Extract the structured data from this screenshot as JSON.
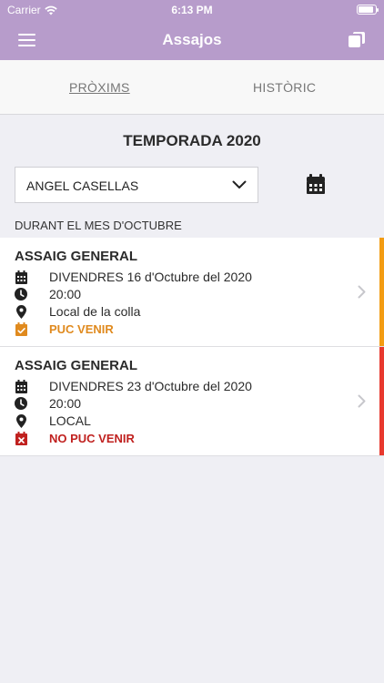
{
  "status_bar": {
    "carrier": "Carrier",
    "time": "6:13 PM",
    "battery_level": 0.9
  },
  "header": {
    "title": "Assajos"
  },
  "tabs": [
    {
      "label": "PRÒXIMS",
      "active": true
    },
    {
      "label": "HISTÒRIC",
      "active": false
    }
  ],
  "season_title": "TEMPORADA 2020",
  "member_select": {
    "value": "ANGEL CASELLAS"
  },
  "month_label": "DURANT EL MES D'OCTUBRE",
  "events": [
    {
      "title": "ASSAIG GENERAL",
      "date": "DIVENDRES 16 d'Octubre del 2020",
      "time": "20:00",
      "location": "Local de la colla",
      "status": "PUC VENIR",
      "status_color": "#e08a1e",
      "stripe_color": "#f39c12"
    },
    {
      "title": "ASSAIG GENERAL",
      "date": "DIVENDRES 23 d'Octubre del 2020",
      "time": "20:00",
      "location": "LOCAL",
      "status": "NO PUC VENIR",
      "status_color": "#c0211f",
      "stripe_color": "#e8392e"
    }
  ],
  "colors": {
    "accent": "#b79ccb",
    "background": "#efeff4"
  }
}
